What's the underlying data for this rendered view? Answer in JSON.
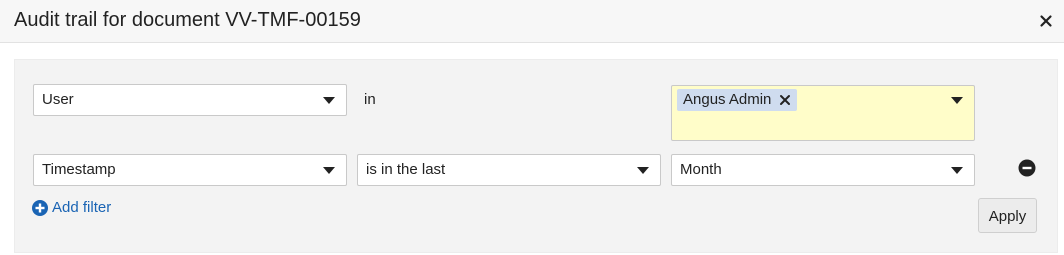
{
  "dialog": {
    "title": "Audit trail for document VV-TMF-00159"
  },
  "filters": [
    {
      "field": "User",
      "operator": "in",
      "values": [
        "Angus Admin"
      ]
    },
    {
      "field": "Timestamp",
      "operator": "is in the last",
      "value": "Month"
    }
  ],
  "actions": {
    "add_filter_label": "Add filter",
    "apply_label": "Apply"
  },
  "icons": {
    "close": "close-icon",
    "token_remove": "remove-token-icon",
    "remove_row": "minus-circle-icon",
    "add": "plus-circle-icon",
    "dropdown": "chevron-down-icon"
  },
  "colors": {
    "link": "#1a64b4",
    "multi_select_bg": "#fffdc9",
    "token_bg": "#cfdcef"
  }
}
